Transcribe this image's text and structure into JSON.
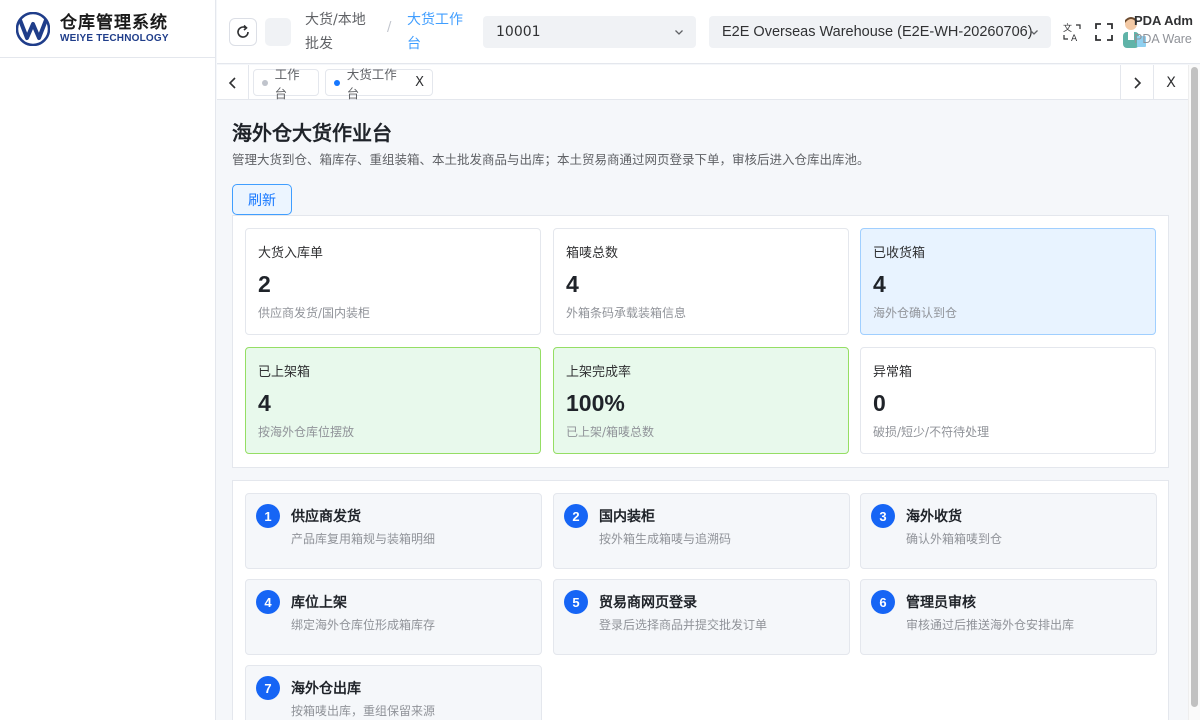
{
  "brand": {
    "name_cn": "仓库管理系统",
    "name_en": "WEIYE TECHNOLOGY",
    "logo_icon": "weiye-logo-icon",
    "brand_color": "#1f3d8a"
  },
  "header": {
    "breadcrumb": [
      "大货/本地批发",
      "大货工作台"
    ],
    "breadcrumb_separator": "/",
    "warehouse_code": "10001",
    "warehouse_name": "E2E Overseas Warehouse (E2E-WH-20260706)",
    "user_name": "PDA Adm",
    "user_role": "PDA Ware",
    "icons": [
      "refresh-icon",
      "translate-icon",
      "fullscreen-icon",
      "avatar"
    ]
  },
  "tabs": [
    {
      "label": "工作台",
      "active": false
    },
    {
      "label": "大货工作台",
      "active": true,
      "close": "X"
    }
  ],
  "tab_controls": {
    "close_all": "X"
  },
  "page": {
    "title": "海外仓大货作业台",
    "description": "管理大货到仓、箱库存、重组装箱、本土批发商品与出库；本土贸易商通过网页登录下单，审核后进入仓库出库池。",
    "refresh_label": "刷新"
  },
  "stats": [
    {
      "label": "大货入库单",
      "value": "2",
      "sub": "供应商发货/国内装柜",
      "tone": "default"
    },
    {
      "label": "箱唛总数",
      "value": "4",
      "sub": "外箱条码承载装箱信息",
      "tone": "default"
    },
    {
      "label": "已收货箱",
      "value": "4",
      "sub": "海外仓确认到仓",
      "tone": "blue"
    },
    {
      "label": "已上架箱",
      "value": "4",
      "sub": "按海外仓库位摆放",
      "tone": "green"
    },
    {
      "label": "上架完成率",
      "value": "100%",
      "sub": "已上架/箱唛总数",
      "tone": "green"
    },
    {
      "label": "异常箱",
      "value": "0",
      "sub": "破损/短少/不符待处理",
      "tone": "default"
    }
  ],
  "steps": [
    {
      "num": "1",
      "title": "供应商发货",
      "desc": "产品库复用箱规与装箱明细"
    },
    {
      "num": "2",
      "title": "国内装柜",
      "desc": "按外箱生成箱唛与追溯码"
    },
    {
      "num": "3",
      "title": "海外收货",
      "desc": "确认外箱箱唛到仓"
    },
    {
      "num": "4",
      "title": "库位上架",
      "desc": "绑定海外仓库位形成箱库存"
    },
    {
      "num": "5",
      "title": "贸易商网页登录",
      "desc": "登录后选择商品并提交批发订单"
    },
    {
      "num": "6",
      "title": "管理员审核",
      "desc": "审核通过后推送海外仓安排出库"
    },
    {
      "num": "7",
      "title": "海外仓出库",
      "desc": "按箱唛出库，重组保留来源"
    }
  ],
  "colors": {
    "primary": "#1677ff",
    "step_badge": "#1665f5",
    "stat_blue_bg": "#e8f3ff",
    "stat_green_bg": "#e8f9ec"
  }
}
